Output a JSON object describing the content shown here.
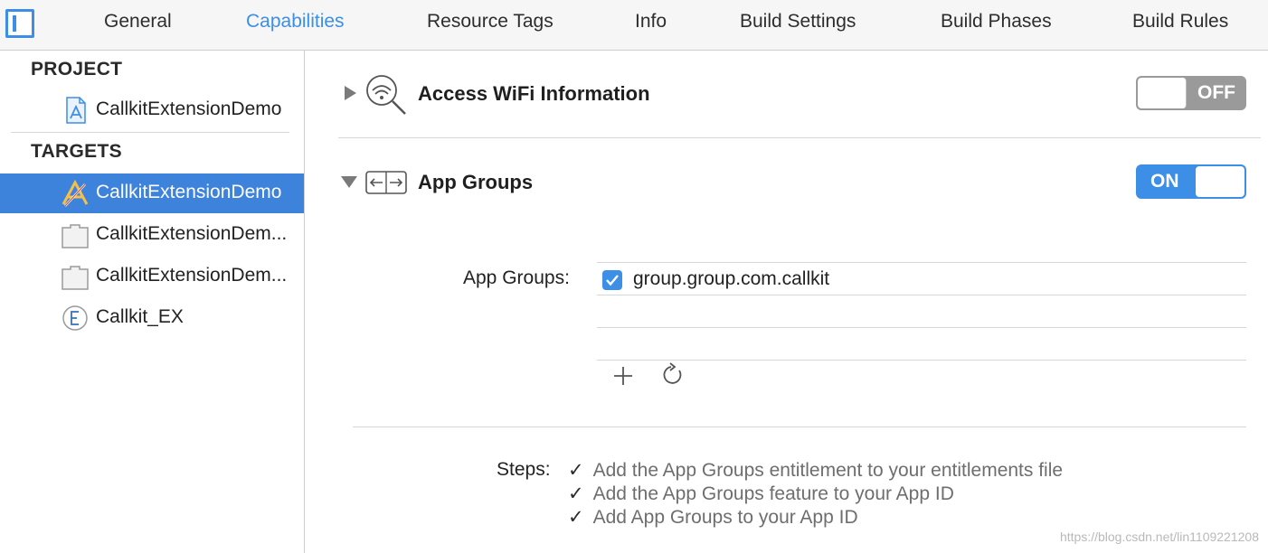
{
  "tabs": [
    {
      "label": "General",
      "active": false
    },
    {
      "label": "Capabilities",
      "active": true
    },
    {
      "label": "Resource Tags",
      "active": false
    },
    {
      "label": "Info",
      "active": false
    },
    {
      "label": "Build Settings",
      "active": false
    },
    {
      "label": "Build Phases",
      "active": false
    },
    {
      "label": "Build Rules",
      "active": false
    }
  ],
  "sidebar": {
    "project_header": "PROJECT",
    "project_item": {
      "label": "CallkitExtensionDemo",
      "icon": "xcode-project-icon"
    },
    "targets_header": "TARGETS",
    "targets": [
      {
        "label": "CallkitExtensionDemo",
        "icon": "app-target-icon",
        "selected": true
      },
      {
        "label": "CallkitExtensionDem...",
        "icon": "extension-target-icon",
        "selected": false
      },
      {
        "label": "CallkitExtensionDem...",
        "icon": "extension-target-icon",
        "selected": false
      },
      {
        "label": "Callkit_EX",
        "icon": "entitlements-e-icon",
        "selected": false
      }
    ]
  },
  "capabilities": [
    {
      "title": "Access WiFi Information",
      "icon": "wifi-magnifier-icon",
      "expanded": false,
      "toggle_label": "OFF",
      "enabled": false
    },
    {
      "title": "App Groups",
      "icon": "app-groups-arrows-icon",
      "expanded": true,
      "toggle_label": "ON",
      "enabled": true
    }
  ],
  "app_groups": {
    "field_label": "App Groups:",
    "items": [
      {
        "name": "group.group.com.callkit",
        "checked": true
      }
    ],
    "add_icon": "plus-icon",
    "refresh_icon": "refresh-icon"
  },
  "steps": {
    "label": "Steps:",
    "items": [
      "Add the App Groups entitlement to your entitlements file",
      "Add the App Groups feature to your App ID",
      "Add App Groups to your App ID"
    ],
    "check_glyph": "✓"
  },
  "watermark": "https://blog.csdn.net/lin1109221208",
  "colors": {
    "accent": "#3d8ee6",
    "selection": "#3d82db",
    "toggle_off": "#9a9a9a"
  }
}
